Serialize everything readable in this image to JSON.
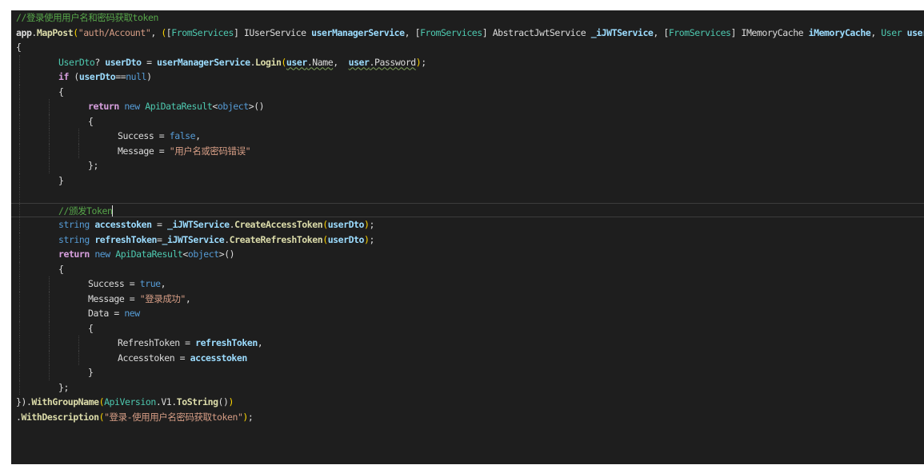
{
  "editor": {
    "colors": {
      "background": "#1e1e1e",
      "comment": "#57a64a",
      "keyword": "#569cd6",
      "string": "#d69d85",
      "type": "#4ec9b0",
      "method": "#dcdcaa",
      "parameter": "#9cdcfe",
      "control": "#d8a0df"
    },
    "lines": [
      {
        "indent": 0,
        "tokens": [
          {
            "t": "comment",
            "v": "//登录使用用户名和密码获取token"
          }
        ]
      },
      {
        "indent": 0,
        "tokens": [
          {
            "t": "bold",
            "v": "app"
          },
          {
            "t": "plain",
            "v": "."
          },
          {
            "t": "method",
            "v": "MapPost"
          },
          {
            "t": "paren",
            "v": "("
          },
          {
            "t": "string",
            "v": "\"auth/Account\""
          },
          {
            "t": "plain",
            "v": ", "
          },
          {
            "t": "paren",
            "v": "("
          },
          {
            "t": "plain",
            "v": "["
          },
          {
            "t": "type",
            "v": "FromServices"
          },
          {
            "t": "plain",
            "v": "] "
          },
          {
            "t": "plain",
            "v": "IUserService "
          },
          {
            "t": "param",
            "v": "userManagerService"
          },
          {
            "t": "plain",
            "v": ", "
          },
          {
            "t": "plain",
            "v": "["
          },
          {
            "t": "type",
            "v": "FromServices"
          },
          {
            "t": "plain",
            "v": "] "
          },
          {
            "t": "plain",
            "v": "AbstractJwtService "
          },
          {
            "t": "param",
            "v": "_iJWTService"
          },
          {
            "t": "plain",
            "v": ", "
          },
          {
            "t": "plain",
            "v": "["
          },
          {
            "t": "type",
            "v": "FromServices"
          },
          {
            "t": "plain",
            "v": "] "
          },
          {
            "t": "plain",
            "v": "IMemoryCache "
          },
          {
            "t": "param",
            "v": "iMemoryCache"
          },
          {
            "t": "plain",
            "v": ", "
          },
          {
            "t": "type",
            "v": "User "
          },
          {
            "t": "param",
            "v": "user"
          },
          {
            "t": "paren",
            "v": ")"
          },
          {
            "t": "plain",
            "v": " =>"
          }
        ]
      },
      {
        "indent": 0,
        "tokens": [
          {
            "t": "plain",
            "v": "{"
          }
        ]
      },
      {
        "indent": 1,
        "tokens": [
          {
            "t": "type",
            "v": "UserDto"
          },
          {
            "t": "plain",
            "v": "? "
          },
          {
            "t": "param",
            "v": "userDto"
          },
          {
            "t": "plain",
            "v": " = "
          },
          {
            "t": "param",
            "v": "userManagerService"
          },
          {
            "t": "plain",
            "v": "."
          },
          {
            "t": "method",
            "v": "Login"
          },
          {
            "t": "paren",
            "v": "("
          },
          {
            "t": "param-sq",
            "v": "user"
          },
          {
            "t": "plain-sq",
            "v": ".Name"
          },
          {
            "t": "plain",
            "v": ",  "
          },
          {
            "t": "param-sq",
            "v": "user"
          },
          {
            "t": "plain-sq",
            "v": ".Password"
          },
          {
            "t": "paren",
            "v": ")"
          },
          {
            "t": "plain",
            "v": ";"
          }
        ]
      },
      {
        "indent": 1,
        "tokens": [
          {
            "t": "ctrl",
            "v": "if"
          },
          {
            "t": "plain",
            "v": " ("
          },
          {
            "t": "param",
            "v": "userDto"
          },
          {
            "t": "plain",
            "v": "=="
          },
          {
            "t": "keyword",
            "v": "null"
          },
          {
            "t": "plain",
            "v": ")"
          }
        ]
      },
      {
        "indent": 1,
        "tokens": [
          {
            "t": "plain",
            "v": "{"
          }
        ]
      },
      {
        "indent": 2,
        "tokens": [
          {
            "t": "ctrl",
            "v": "return"
          },
          {
            "t": "plain",
            "v": " "
          },
          {
            "t": "keyword",
            "v": "new"
          },
          {
            "t": "plain",
            "v": " "
          },
          {
            "t": "type",
            "v": "ApiDataResult"
          },
          {
            "t": "plain",
            "v": "<"
          },
          {
            "t": "keyword",
            "v": "object"
          },
          {
            "t": "plain",
            "v": ">()"
          }
        ]
      },
      {
        "indent": 2,
        "tokens": [
          {
            "t": "plain",
            "v": "{"
          }
        ]
      },
      {
        "indent": 3,
        "tokens": [
          {
            "t": "plain",
            "v": "Success = "
          },
          {
            "t": "keyword",
            "v": "false"
          },
          {
            "t": "plain",
            "v": ","
          }
        ]
      },
      {
        "indent": 3,
        "tokens": [
          {
            "t": "plain",
            "v": "Message = "
          },
          {
            "t": "string",
            "v": "\"用户名或密码错误\""
          }
        ]
      },
      {
        "indent": 2,
        "tokens": [
          {
            "t": "plain",
            "v": "};"
          }
        ]
      },
      {
        "indent": 1,
        "tokens": [
          {
            "t": "plain",
            "v": "}"
          }
        ]
      },
      {
        "indent": 1,
        "tokens": []
      },
      {
        "indent": 1,
        "current": true,
        "tokens": [
          {
            "t": "comment",
            "v": "//颁发Token"
          },
          {
            "t": "caret",
            "v": ""
          }
        ]
      },
      {
        "indent": 1,
        "tokens": [
          {
            "t": "keyword",
            "v": "string"
          },
          {
            "t": "plain",
            "v": " "
          },
          {
            "t": "param",
            "v": "accesstoken"
          },
          {
            "t": "plain",
            "v": " = "
          },
          {
            "t": "param",
            "v": "_iJWTService"
          },
          {
            "t": "plain",
            "v": "."
          },
          {
            "t": "method",
            "v": "CreateAccessToken"
          },
          {
            "t": "paren",
            "v": "("
          },
          {
            "t": "param",
            "v": "userDto"
          },
          {
            "t": "paren",
            "v": ")"
          },
          {
            "t": "plain",
            "v": ";"
          }
        ]
      },
      {
        "indent": 1,
        "tokens": [
          {
            "t": "keyword",
            "v": "string"
          },
          {
            "t": "plain",
            "v": " "
          },
          {
            "t": "param",
            "v": "refreshToken"
          },
          {
            "t": "plain",
            "v": "="
          },
          {
            "t": "param",
            "v": "_iJWTService"
          },
          {
            "t": "plain",
            "v": "."
          },
          {
            "t": "method",
            "v": "CreateRefreshToken"
          },
          {
            "t": "paren",
            "v": "("
          },
          {
            "t": "param",
            "v": "userDto"
          },
          {
            "t": "paren",
            "v": ")"
          },
          {
            "t": "plain",
            "v": ";"
          }
        ]
      },
      {
        "indent": 1,
        "tokens": [
          {
            "t": "ctrl",
            "v": "return"
          },
          {
            "t": "plain",
            "v": " "
          },
          {
            "t": "keyword",
            "v": "new"
          },
          {
            "t": "plain",
            "v": " "
          },
          {
            "t": "type",
            "v": "ApiDataResult"
          },
          {
            "t": "plain",
            "v": "<"
          },
          {
            "t": "keyword",
            "v": "object"
          },
          {
            "t": "plain",
            "v": ">()"
          }
        ]
      },
      {
        "indent": 1,
        "tokens": [
          {
            "t": "plain",
            "v": "{"
          }
        ]
      },
      {
        "indent": 2,
        "tokens": [
          {
            "t": "plain",
            "v": "Success = "
          },
          {
            "t": "keyword",
            "v": "true"
          },
          {
            "t": "plain",
            "v": ","
          }
        ]
      },
      {
        "indent": 2,
        "tokens": [
          {
            "t": "plain",
            "v": "Message = "
          },
          {
            "t": "string",
            "v": "\"登录成功\""
          },
          {
            "t": "plain",
            "v": ","
          }
        ]
      },
      {
        "indent": 2,
        "tokens": [
          {
            "t": "plain",
            "v": "Data = "
          },
          {
            "t": "keyword",
            "v": "new"
          }
        ]
      },
      {
        "indent": 2,
        "tokens": [
          {
            "t": "plain",
            "v": "{"
          }
        ]
      },
      {
        "indent": 3,
        "tokens": [
          {
            "t": "plain",
            "v": "RefreshToken = "
          },
          {
            "t": "param",
            "v": "refreshToken"
          },
          {
            "t": "plain",
            "v": ","
          }
        ]
      },
      {
        "indent": 3,
        "tokens": [
          {
            "t": "plain",
            "v": "Accesstoken = "
          },
          {
            "t": "param",
            "v": "accesstoken"
          }
        ]
      },
      {
        "indent": 2,
        "tokens": [
          {
            "t": "plain",
            "v": "}"
          }
        ]
      },
      {
        "indent": 1,
        "tokens": [
          {
            "t": "plain",
            "v": "};"
          }
        ]
      },
      {
        "indent": 0,
        "tokens": [
          {
            "t": "plain",
            "v": "})."
          },
          {
            "t": "method",
            "v": "WithGroupName"
          },
          {
            "t": "paren",
            "v": "("
          },
          {
            "t": "type",
            "v": "ApiVersion"
          },
          {
            "t": "plain",
            "v": "."
          },
          {
            "t": "plain",
            "v": "V1"
          },
          {
            "t": "plain",
            "v": "."
          },
          {
            "t": "method",
            "v": "ToString"
          },
          {
            "t": "plain",
            "v": "()"
          },
          {
            "t": "paren",
            "v": ")"
          }
        ]
      },
      {
        "indent": 0,
        "tokens": [
          {
            "t": "plain",
            "v": "."
          },
          {
            "t": "method",
            "v": "WithDescription"
          },
          {
            "t": "paren",
            "v": "("
          },
          {
            "t": "string",
            "v": "\"登录-使用用户名密码获取token\""
          },
          {
            "t": "paren",
            "v": ")"
          },
          {
            "t": "plain",
            "v": ";"
          }
        ]
      }
    ]
  }
}
